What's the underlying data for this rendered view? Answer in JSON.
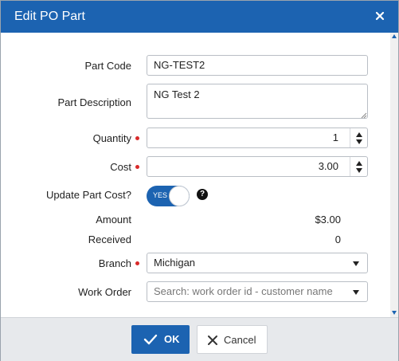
{
  "dialog": {
    "title": "Edit PO Part",
    "close_icon": "close-icon"
  },
  "fields": {
    "part_code": {
      "label": "Part Code",
      "value": "NG-TEST2"
    },
    "part_description": {
      "label": "Part Description",
      "value": "NG Test 2"
    },
    "quantity": {
      "label": "Quantity",
      "value": "1",
      "required": true
    },
    "cost": {
      "label": "Cost",
      "value": "3.00",
      "required": true
    },
    "update_part_cost": {
      "label": "Update Part Cost?",
      "toggle_text": "YES",
      "on": true
    },
    "amount": {
      "label": "Amount",
      "value": "$3.00"
    },
    "received": {
      "label": "Received",
      "value": "0"
    },
    "branch": {
      "label": "Branch",
      "value": "Michigan",
      "required": true
    },
    "work_order": {
      "label": "Work Order",
      "placeholder": "Search: work order id - customer name"
    }
  },
  "help_icon": "?",
  "footer": {
    "ok_label": "OK",
    "cancel_label": "Cancel"
  },
  "colors": {
    "accent": "#1c63b1",
    "required": "#d92a2a"
  }
}
